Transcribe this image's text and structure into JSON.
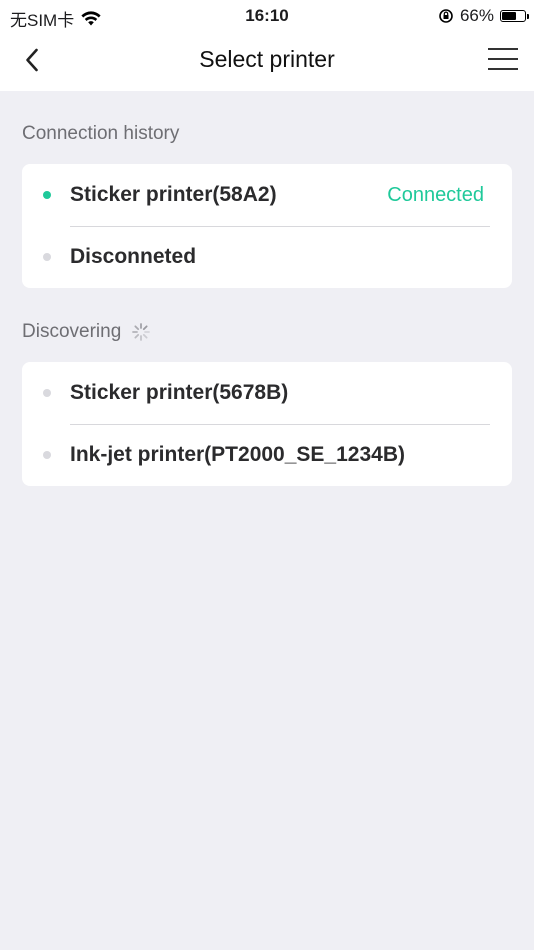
{
  "status_bar": {
    "carrier": "无SIM卡",
    "time": "16:10",
    "battery_percent": "66%",
    "battery_level": 0.66
  },
  "nav": {
    "title": "Select printer",
    "back_icon": "chevron-left-icon",
    "menu_icon": "hamburger-menu-icon"
  },
  "history": {
    "header": "Connection history",
    "items": [
      {
        "label": "Sticker printer(58A2)",
        "status": "Connected",
        "dot_color": "#1fc99a"
      },
      {
        "label": "Disconneted",
        "status": "",
        "dot_color": "#d9d9de"
      }
    ]
  },
  "discovering": {
    "header": "Discovering",
    "items": [
      {
        "label": "Sticker printer(5678B)",
        "dot_color": "#d9d9de"
      },
      {
        "label": "Ink-jet printer(PT2000_SE_1234B)",
        "dot_color": "#d9d9de"
      }
    ]
  },
  "colors": {
    "accent": "#1fc99a",
    "background": "#efeff4",
    "card": "#ffffff"
  }
}
